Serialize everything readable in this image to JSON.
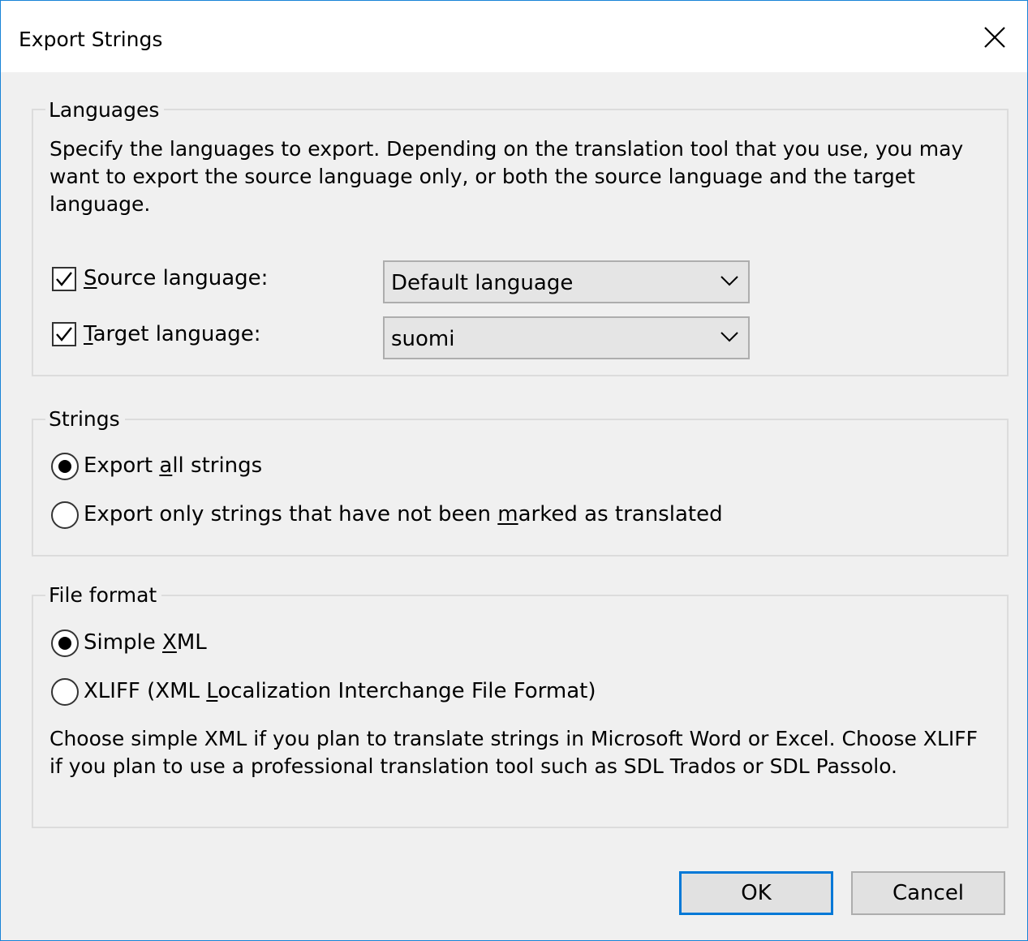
{
  "window": {
    "title": "Export Strings"
  },
  "languages": {
    "legend": "Languages",
    "description": "Specify the languages to export. Depending on the translation tool that you use, you may want to export the source language only, or both the source language and the target language.",
    "source": {
      "label_key": "S",
      "label_rest": "ource language:",
      "checked": true,
      "value": "Default language"
    },
    "target": {
      "label_key": "T",
      "label_rest": "arget language:",
      "checked": true,
      "value": "suomi"
    }
  },
  "strings": {
    "legend": "Strings",
    "option_all": {
      "pre": "Export ",
      "key": "a",
      "post": "ll strings",
      "selected": true
    },
    "option_unmarked": {
      "pre": "Export only strings that have not been ",
      "key": "m",
      "post": "arked as translated",
      "selected": false
    }
  },
  "file_format": {
    "legend": "File format",
    "option_xml": {
      "pre": "Simple ",
      "key": "X",
      "post": "ML",
      "selected": true
    },
    "option_xliff": {
      "pre": "XLIFF (XML ",
      "key": "L",
      "post": "ocalization Interchange File Format)",
      "selected": false
    },
    "note": "Choose simple XML if you plan to translate strings in Microsoft Word or Excel. Choose XLIFF if you plan to use a professional translation tool such as SDL Trados or SDL Passolo."
  },
  "buttons": {
    "ok": "OK",
    "cancel": "Cancel"
  },
  "colors": {
    "accent": "#0078d7",
    "window_border": "#1883d7",
    "dialog_bg": "#f0f0f0"
  }
}
